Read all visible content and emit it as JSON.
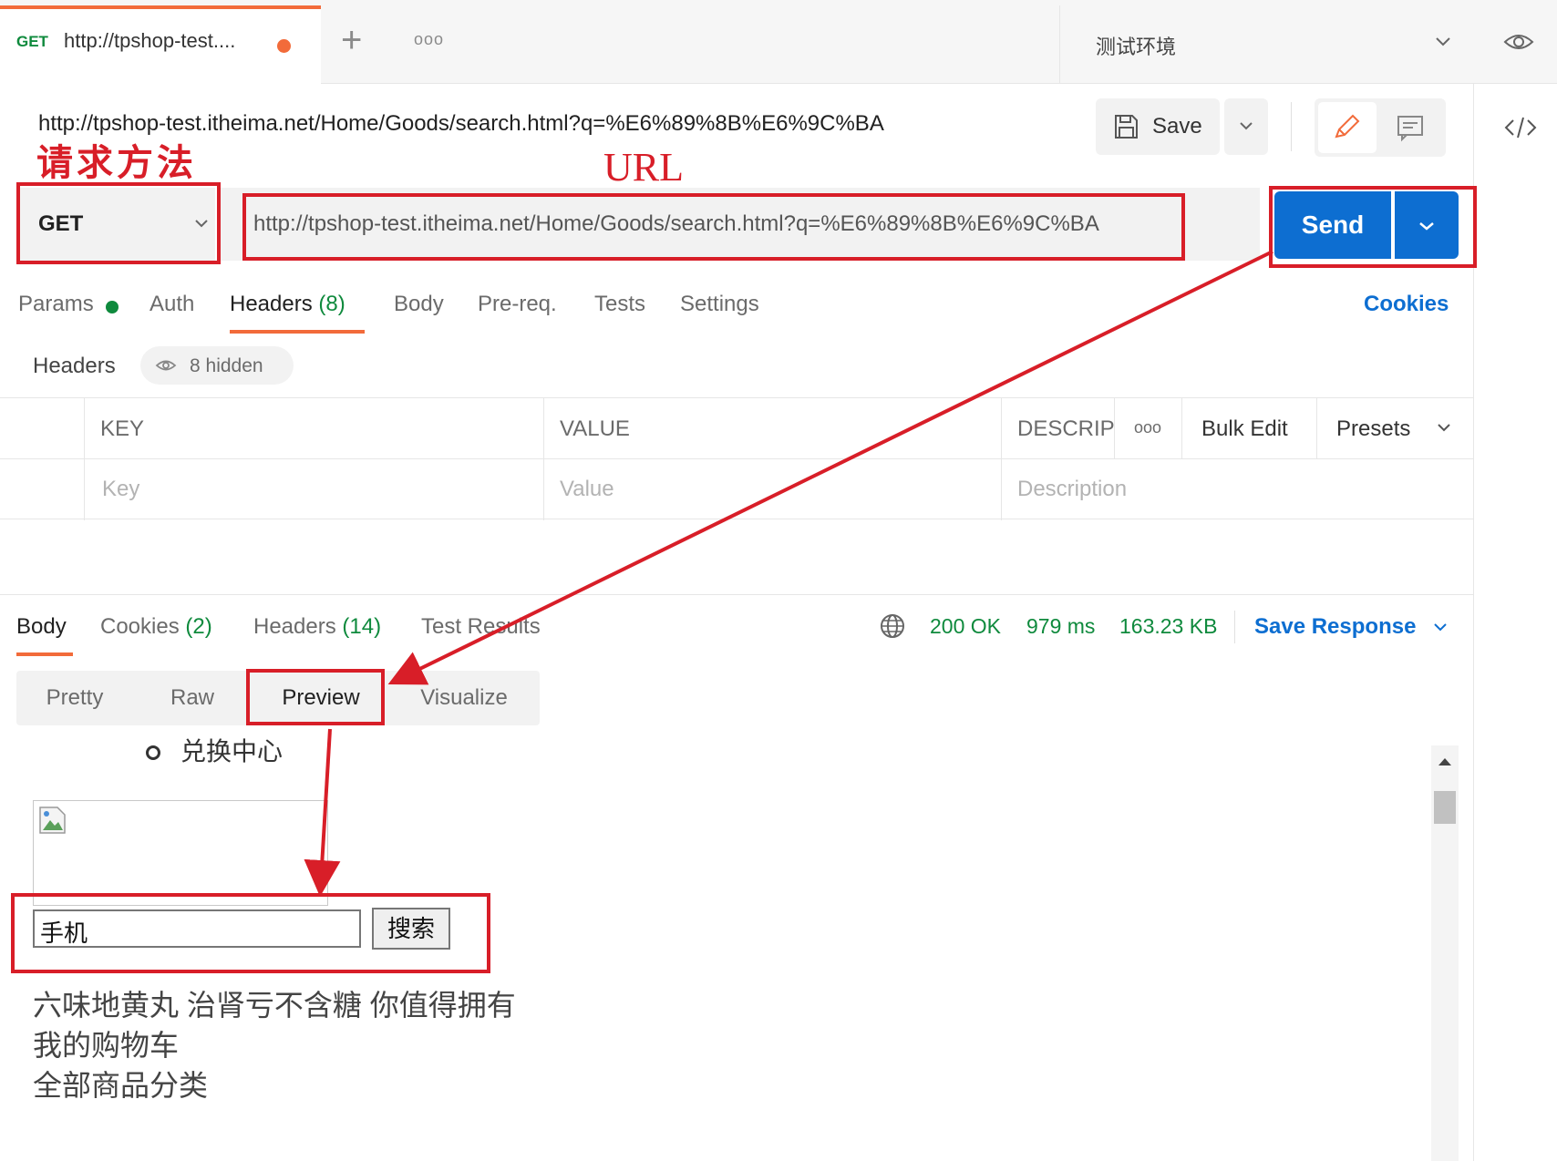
{
  "tab": {
    "method": "GET",
    "title": "http://tpshop-test....",
    "more": "ooo"
  },
  "environment": {
    "label": "测试环境"
  },
  "request": {
    "title": "http://tpshop-test.itheima.net/Home/Goods/search.html?q=%E6%89%8B%E6%9C%BA",
    "method": "GET",
    "url": "http://tpshop-test.itheima.net/Home/Goods/search.html?q=%E6%89%8B%E6%9C%BA",
    "save_label": "Save",
    "send_label": "Send"
  },
  "annotations": {
    "method_label": "请求方法",
    "url_label": "URL",
    "color": "#d81e28"
  },
  "request_tabs": {
    "params": "Params",
    "auth": "Auth",
    "headers": "Headers",
    "headers_count": "(8)",
    "body": "Body",
    "prereq": "Pre-req.",
    "tests": "Tests",
    "settings": "Settings",
    "cookies": "Cookies"
  },
  "headers_section": {
    "label": "Headers",
    "hidden": "8 hidden"
  },
  "table": {
    "columns": {
      "key": "KEY",
      "value": "VALUE",
      "description": "DESCRIP",
      "more": "ooo",
      "bulk_edit": "Bulk Edit",
      "presets": "Presets"
    },
    "placeholders": {
      "key": "Key",
      "value": "Value",
      "description": "Description"
    }
  },
  "response": {
    "tabs": {
      "body": "Body",
      "cookies": "Cookies",
      "cookies_count": "(2)",
      "headers": "Headers",
      "headers_count": "(14)",
      "test_results": "Test Results"
    },
    "status": "200 OK",
    "time": "979 ms",
    "size": "163.23 KB",
    "save_response": "Save Response",
    "views": {
      "pretty": "Pretty",
      "raw": "Raw",
      "preview": "Preview",
      "visualize": "Visualize"
    }
  },
  "preview": {
    "list_item": "兑换中心",
    "search_value": "手机",
    "search_button": "搜索",
    "lines": [
      "六味地黄丸 治肾亏不含糖 你值得拥有",
      "我的购物车",
      "全部商品分类"
    ]
  },
  "colors": {
    "accent": "#f26b3a",
    "primary": "#0d6ed1",
    "success": "#0f8a3d",
    "annotation": "#d81e28"
  }
}
